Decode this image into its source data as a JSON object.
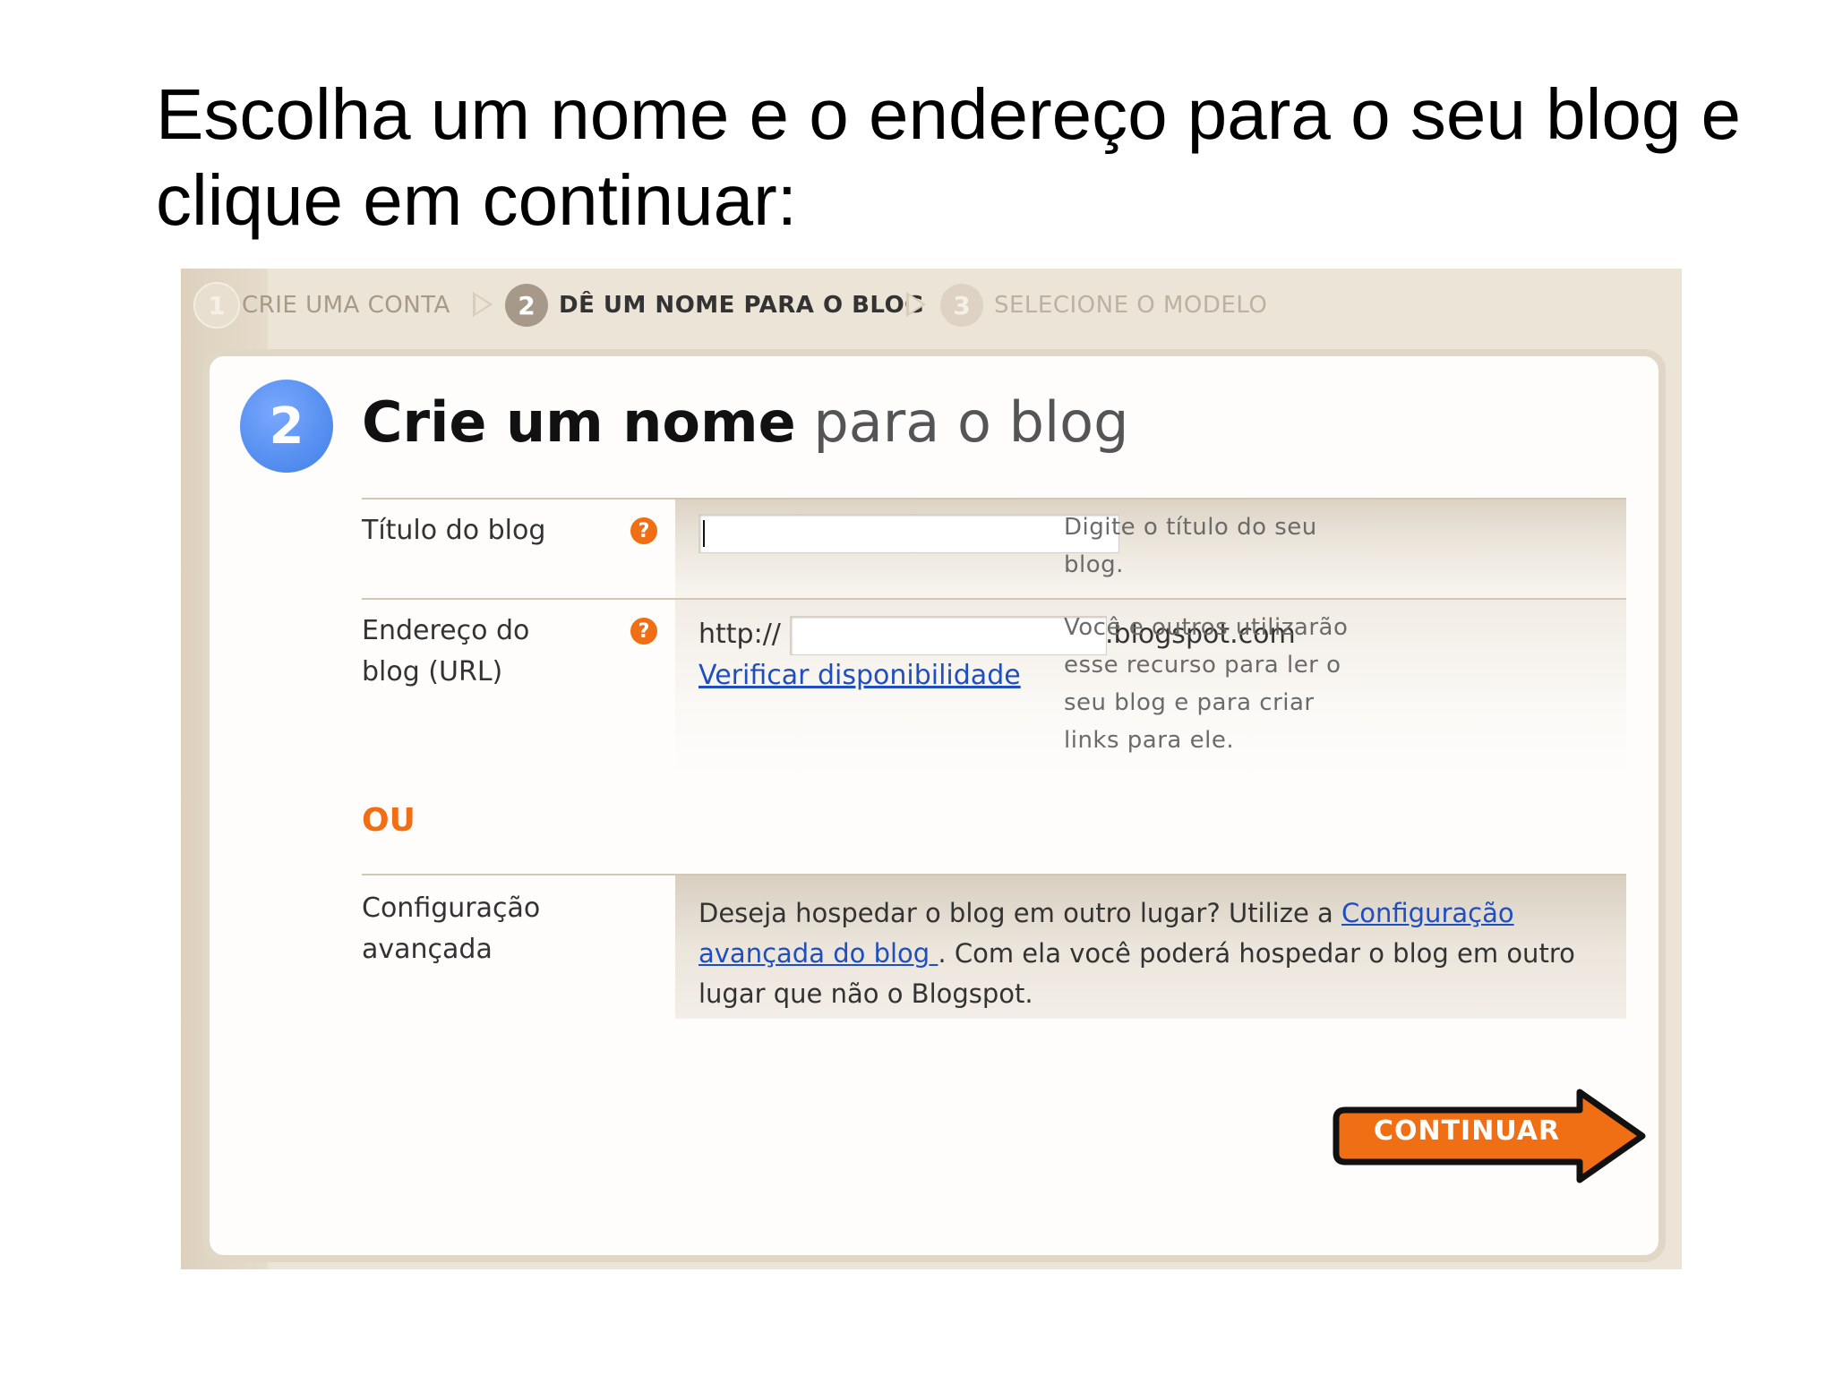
{
  "slide": {
    "title": "Escolha um nome e o endereço para o seu blog e clique em continuar:"
  },
  "steps": [
    {
      "num": "1",
      "label": "CRIE UMA CONTA",
      "state": "done"
    },
    {
      "num": "2",
      "label": "DÊ UM NOME PARA O BLOG",
      "state": "active"
    },
    {
      "num": "3",
      "label": "SELECIONE O MODELO",
      "state": "pending"
    }
  ],
  "card": {
    "step_num": "2",
    "title_bold": "Crie um nome",
    "title_light": "para o blog"
  },
  "fields": {
    "blog_title": {
      "label": "Título do blog",
      "help_icon": "question-icon",
      "value": "",
      "hint": "Digite o título do seu blog."
    },
    "blog_address": {
      "label": "Endereço do blog (URL)",
      "help_icon": "question-icon",
      "prefix": "http://",
      "value": "",
      "suffix": ".blogspot.com",
      "check_link": "Verificar disponibilidade",
      "hint": "Você e outros utilizarão esse recurso para ler o seu blog e para criar links para ele."
    }
  },
  "or_label": "OU",
  "advanced": {
    "label": "Configuração avançada",
    "text_before": "Deseja hospedar o blog em outro lugar? Utilize a ",
    "link": "Configuração avançada do blog ",
    "text_after": ". Com ela você poderá hospedar o blog em outro lugar que não o Blogspot."
  },
  "continue_button": {
    "label": "CONTINUAR",
    "color": "#f06e14"
  },
  "colors": {
    "accent_orange": "#f06e14",
    "step_blue": "#3f7fe6",
    "link_blue": "#1f4fbf",
    "frame_beige": "#ece4d6"
  }
}
